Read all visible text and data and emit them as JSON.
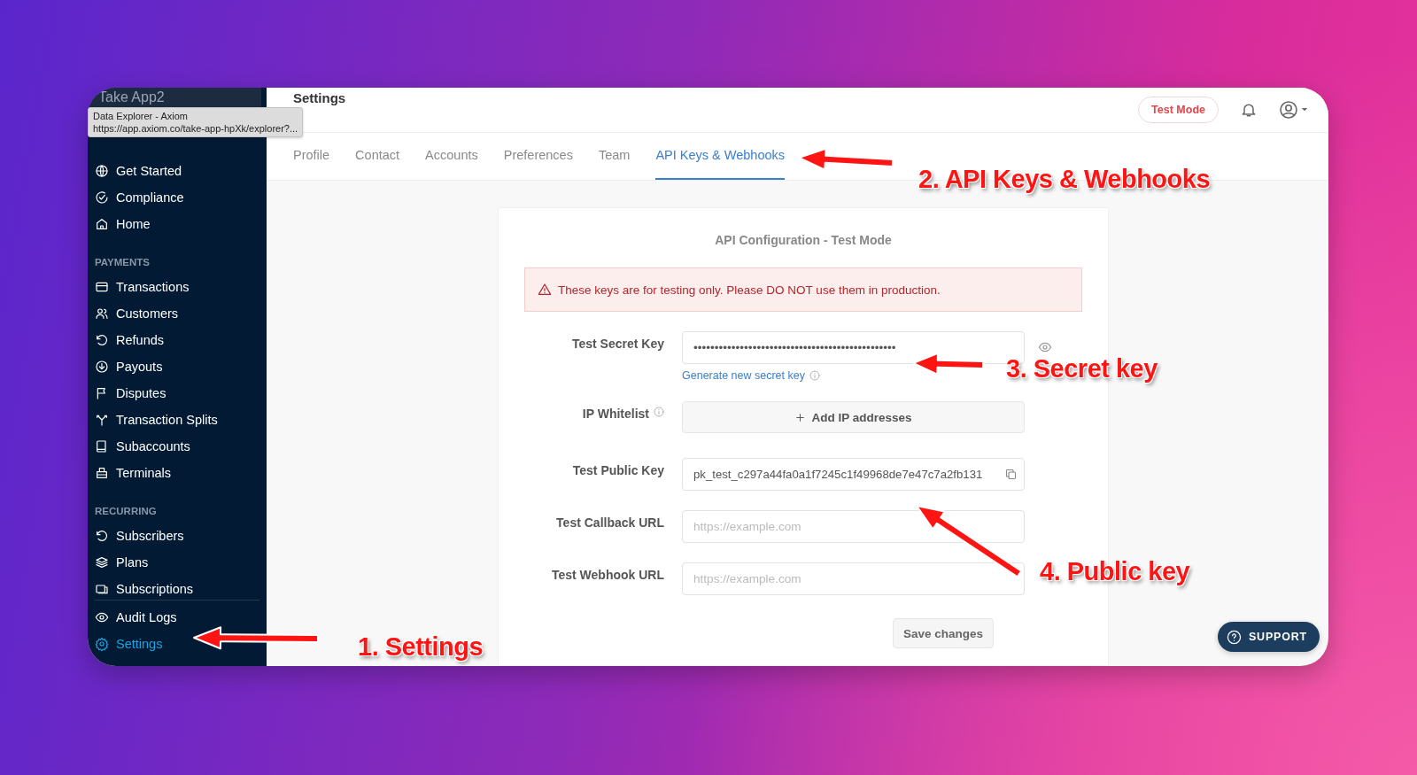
{
  "browser_tooltip": {
    "title": "Data Explorer - Axiom",
    "url": "https://app.axiom.co/take-app-hpXk/explorer?..."
  },
  "sidebar": {
    "brand": "Take App2",
    "groups": [
      {
        "items": [
          {
            "label": "Get Started",
            "selected": false
          },
          {
            "label": "Compliance",
            "selected": false
          },
          {
            "label": "Home",
            "selected": false
          }
        ]
      },
      {
        "heading": "PAYMENTS",
        "items": [
          {
            "label": "Transactions",
            "selected": false
          },
          {
            "label": "Customers",
            "selected": false
          },
          {
            "label": "Refunds",
            "selected": false
          },
          {
            "label": "Payouts",
            "selected": false
          },
          {
            "label": "Disputes",
            "selected": false
          },
          {
            "label": "Transaction Splits",
            "selected": false
          },
          {
            "label": "Subaccounts",
            "selected": false
          },
          {
            "label": "Terminals",
            "selected": false
          }
        ]
      },
      {
        "heading": "RECURRING",
        "items": [
          {
            "label": "Subscribers",
            "selected": false
          },
          {
            "label": "Plans",
            "selected": false
          },
          {
            "label": "Subscriptions",
            "selected": false
          }
        ]
      }
    ],
    "footer_items": [
      {
        "label": "Audit Logs",
        "selected": false
      },
      {
        "label": "Settings",
        "selected": true
      }
    ]
  },
  "header": {
    "title": "Settings",
    "mode_button": "Test Mode"
  },
  "tabs": [
    {
      "label": "Profile",
      "selected": false
    },
    {
      "label": "Contact",
      "selected": false
    },
    {
      "label": "Accounts",
      "selected": false
    },
    {
      "label": "Preferences",
      "selected": false
    },
    {
      "label": "Team",
      "selected": false
    },
    {
      "label": "API Keys & Webhooks",
      "selected": true
    }
  ],
  "card": {
    "title": "API Configuration - Test Mode",
    "alert": "These keys are for testing only. Please DO NOT use them in production.",
    "fields": [
      {
        "kind": "secret",
        "label": "Test Secret Key",
        "value": "••••••••••••••••••••••••••••••••••••••••••••••••",
        "link": "Generate new secret key"
      },
      {
        "kind": "action",
        "label": "IP Whitelist",
        "button": "Add IP addresses"
      },
      {
        "kind": "copy",
        "label": "Test Public Key",
        "value": "pk_test_c297a44fa0a1f7245c1f49968de7e47c7a2fb131"
      },
      {
        "kind": "url",
        "label": "Test Callback URL",
        "placeholder": "https://example.com"
      },
      {
        "kind": "url",
        "label": "Test Webhook URL",
        "placeholder": "https://example.com"
      }
    ],
    "save_button": "Save changes"
  },
  "support_button": "SUPPORT",
  "annotations": [
    {
      "text": "1. Settings"
    },
    {
      "text": "2. API Keys & Webhooks"
    },
    {
      "text": "3. Secret key"
    },
    {
      "text": "4. Public key"
    }
  ]
}
